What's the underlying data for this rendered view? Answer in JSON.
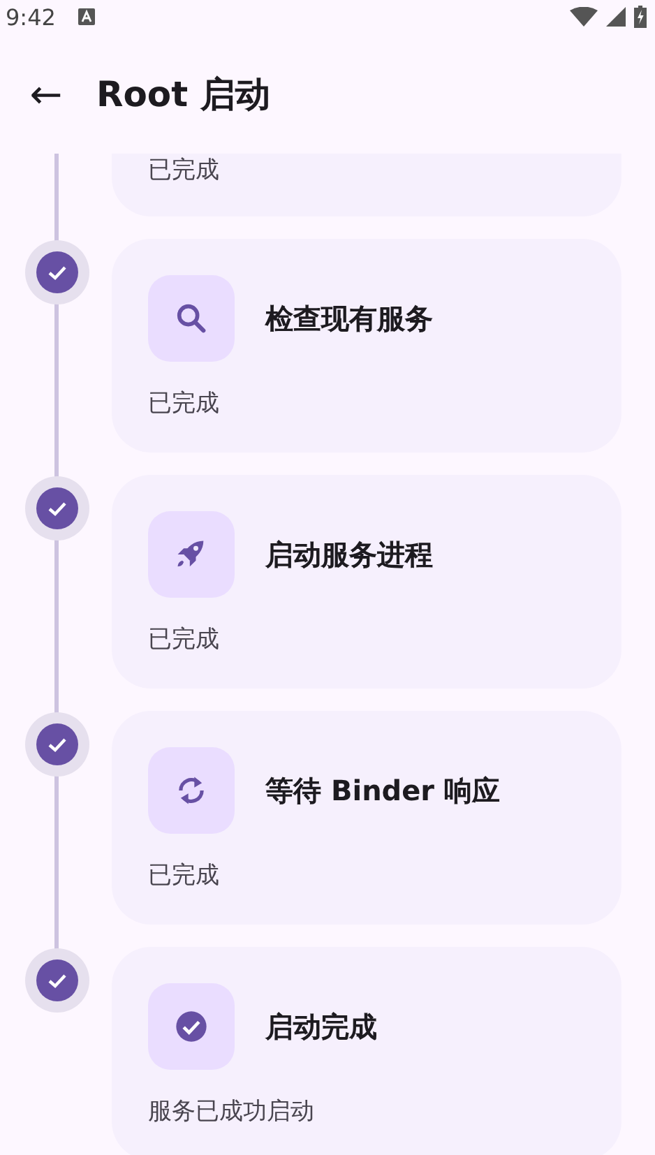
{
  "status_bar": {
    "time": "9:42"
  },
  "app_bar": {
    "back": "←",
    "title": "Root 启动"
  },
  "steps": [
    {
      "kind": "partial",
      "status": "已完成"
    },
    {
      "kind": "search",
      "done": true,
      "title": "检查现有服务",
      "status": "已完成"
    },
    {
      "kind": "rocket",
      "done": true,
      "title": "启动服务进程",
      "status": "已完成"
    },
    {
      "kind": "sync",
      "done": true,
      "title": "等待 Binder 响应",
      "status": "已完成"
    },
    {
      "kind": "check",
      "done": true,
      "title": "启动完成",
      "status": "服务已成功启动"
    }
  ]
}
